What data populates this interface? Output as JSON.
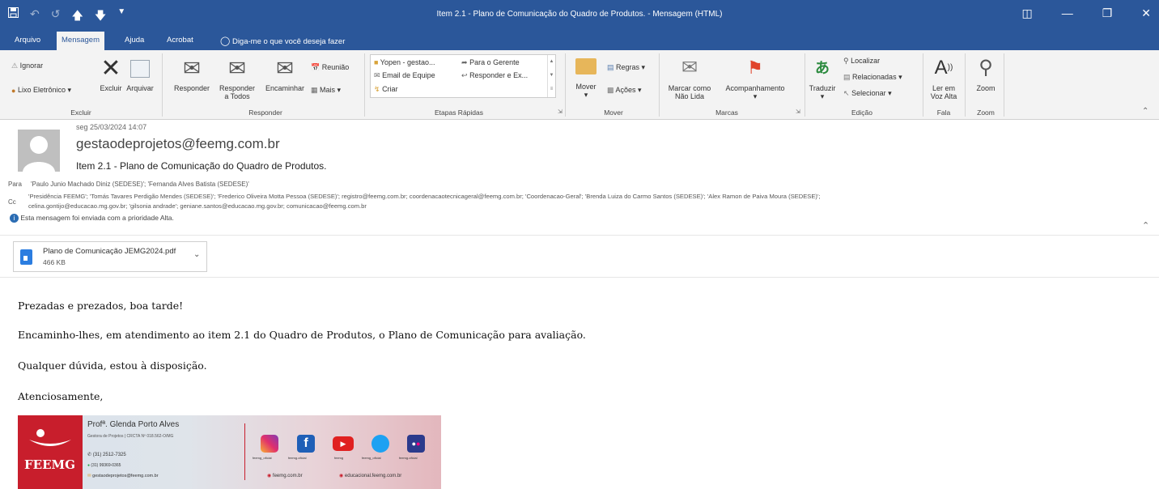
{
  "window": {
    "title": "Item 2.1 - Plano de Comunicação do Quadro de Produtos.  -  Mensagem (HTML)"
  },
  "tabs": [
    "Arquivo",
    "Mensagem",
    "Ajuda",
    "Acrobat"
  ],
  "tell_me": "Diga-me o que você deseja fazer",
  "ribbon": {
    "excluir": {
      "ignorar": "Ignorar",
      "lixo": "Lixo Eletrônico",
      "excluir": "Excluir",
      "arquivar": "Arquivar",
      "label": "Excluir"
    },
    "responder": {
      "responder": "Responder",
      "responder_todos_1": "Responder",
      "responder_todos_2": "a Todos",
      "encaminhar": "Encaminhar",
      "reuniao": "Reunião",
      "mais": "Mais",
      "label": "Responder"
    },
    "etapas": {
      "item1": "Yopen - gestao...",
      "item2": "Para o Gerente",
      "item3": "Email de Equipe",
      "item4": "Responder e Ex...",
      "item5": "Criar",
      "label": "Etapas Rápidas"
    },
    "mover": {
      "mover": "Mover",
      "regras": "Regras",
      "acoes": "Ações",
      "label": "Mover"
    },
    "marcas": {
      "marcar_1": "Marcar como",
      "marcar_2": "Não Lida",
      "acompanhamento": "Acompanhamento",
      "label": "Marcas"
    },
    "edicao": {
      "traduzir": "Traduzir",
      "localizar": "Localizar",
      "relacionadas": "Relacionadas",
      "selecionar": "Selecionar",
      "label": "Edição"
    },
    "fala": {
      "ler_1": "Ler em",
      "ler_2": "Voz Alta",
      "label": "Fala"
    },
    "zoom": {
      "zoom": "Zoom",
      "label": "Zoom"
    }
  },
  "message": {
    "date": "seg 25/03/2024 14:07",
    "from": "gestaodeprojetos@feemg.com.br",
    "subject": "Item 2.1 - Plano de Comunicação do Quadro de Produtos.",
    "to_label": "Para",
    "to": "'Paulo Junio Machado Diniz (SEDESE)'; 'Fernanda Alves Batista (SEDESE)'",
    "cc_label": "Cc",
    "cc_line1": "'Presidência  FEEMG'; 'Tomás Tavares Perdigão Mendes (SEDESE)'; 'Frederico Oliveira Motta Pessoa (SEDESE)'; registro@feemg.com.br; coordenacaotecnicageral@feemg.com.br; 'Coordenacao-Geral'; 'Brenda Luiza do Carmo Santos (SEDESE)'; 'Alex Ramon de Paiva Moura (SEDESE)';",
    "cc_line2": "celina.gontijo@educacao.mg.gov.br; 'gilsonia andrade'; geniane.santos@educacao.mg.gov.br; comunicacao@feemg.com.br",
    "priority": "Esta mensagem foi enviada com a prioridade Alta.",
    "attachment": {
      "name": "Plano de Comunicação JEMG2024.pdf",
      "size": "466 KB"
    },
    "body": [
      "Prezadas e prezados, boa tarde!",
      "Encaminho-lhes, em atendimento ao item 2.1 do Quadro de Produtos, o Plano de Comunicação para avaliação.",
      "Qualquer dúvida, estou à disposição.",
      "Atenciosamente,"
    ]
  },
  "signature": {
    "name": "Profª. Glenda Porto Alves",
    "role": "Gestora de Projetos | CRCTA Nº 018.562-O/MG",
    "phone1": "(31) 2512-7325",
    "phone2": "(31) 99369-0365",
    "email": "gestaodeprojetos@feemg.com.br",
    "logo_text": "FEEMG",
    "social": [
      "feemg_oficial",
      "feemg.oficial",
      "feemg",
      "feemg_oficial",
      "feemg.oficial"
    ],
    "site1": "feemg.com.br",
    "site2": "educacional.feemg.com.br"
  }
}
